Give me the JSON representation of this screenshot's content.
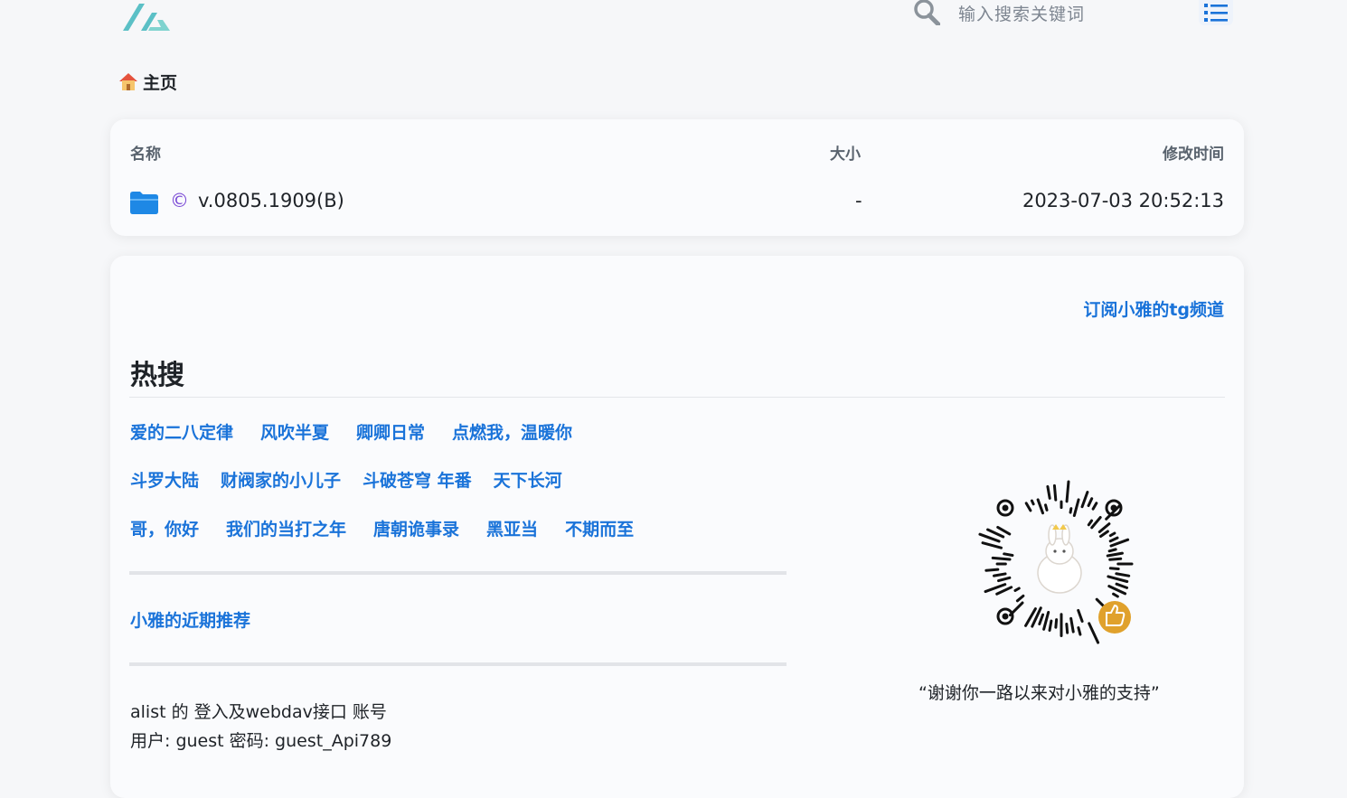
{
  "header": {
    "logo_icon": "alist-logo-icon",
    "search_placeholder": "输入搜索关键词",
    "search_icon": "search-icon",
    "menu_icon": "list-menu-icon"
  },
  "breadcrumb": {
    "home_icon": "house-icon",
    "label": "主页"
  },
  "file_list": {
    "columns": {
      "name": "名称",
      "size": "大小",
      "modified": "修改时间"
    },
    "rows": [
      {
        "icon": "folder-icon",
        "prefix": "©",
        "name": "v.0805.1909(B)",
        "size": "-",
        "modified": "2023-07-03 20:52:13"
      }
    ]
  },
  "readme": {
    "tg_link": "订阅小雅的tg频道",
    "hot_title": "热搜",
    "hot_rows": [
      [
        "爱的二八定律",
        "风吹半夏",
        "卿卿日常",
        "点燃我，温暖你"
      ],
      [
        "斗罗大陆",
        "财阀家的小儿子",
        "斗破苍穹 年番",
        "天下长河"
      ],
      [
        "哥，你好",
        "我们的当打之年",
        "唐朝诡事录",
        "黑亚当",
        "不期而至"
      ]
    ],
    "recommend": "小雅的近期推荐",
    "account_line1": "alist 的 登入及webdav接口 账号",
    "account_line2": "用户: guest 密码: guest_Api789",
    "qr_icon": "qr-code-icon",
    "thanks": "“谢谢你一路以来对小雅的支持”"
  },
  "colors": {
    "accent": "#1a73d9",
    "background": "#f6f7f9",
    "card": "#fafbfd"
  }
}
